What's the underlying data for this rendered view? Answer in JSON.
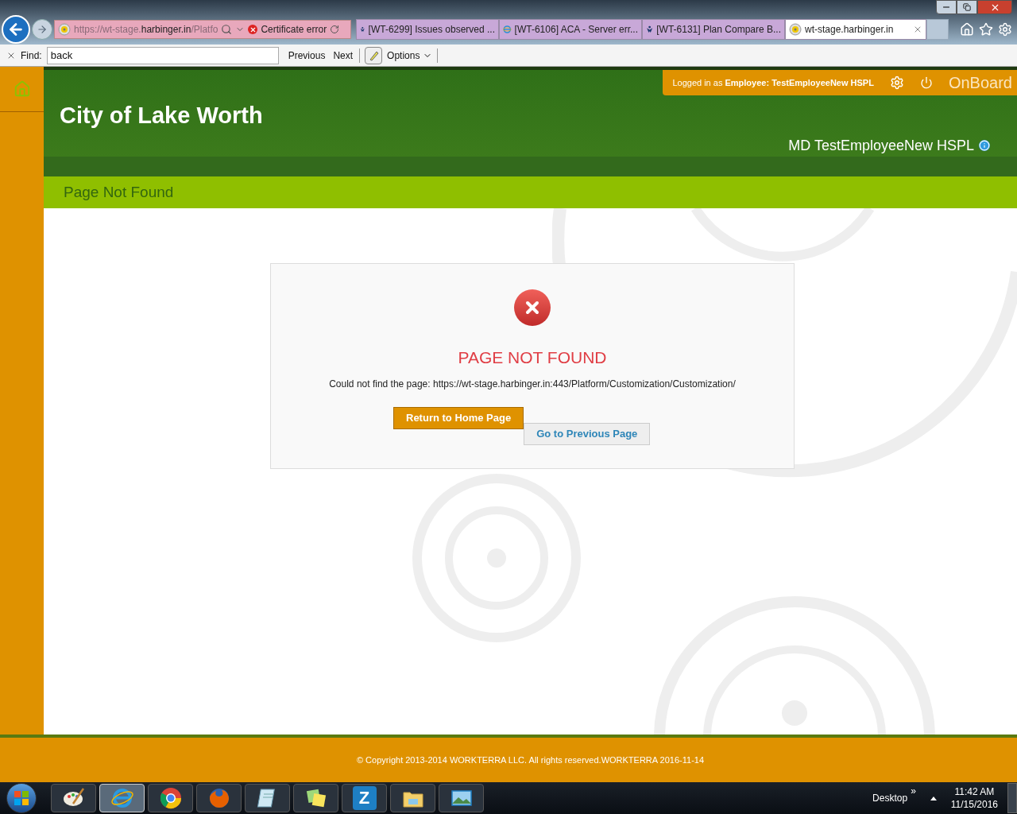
{
  "browser": {
    "address": {
      "prefix": "https://wt-stage.",
      "host": "harbinger.in",
      "rest": "/Platfo"
    },
    "certificate": "Certificate error",
    "tabs": [
      {
        "label": "[WT-6299] Issues observed ...",
        "kind": "jira",
        "selected": false
      },
      {
        "label": "[WT-6106] ACA - Server err...",
        "kind": "ie",
        "selected": false
      },
      {
        "label": "[WT-6131] Plan Compare B...",
        "kind": "jira",
        "selected": false
      },
      {
        "label": "wt-stage.harbinger.in",
        "kind": "site",
        "selected": true
      }
    ],
    "find": {
      "label": "Find:",
      "value": "back",
      "previous": "Previous",
      "next": "Next",
      "options": "Options"
    }
  },
  "header": {
    "org": "City of Lake Worth",
    "login": "Logged in as **Employee:  TestEmployeeNew HSPL**",
    "app": "OnBoard",
    "user": "MD TestEmployeeNew HSPL"
  },
  "page_title": "Page Not Found",
  "error": {
    "title": "PAGE NOT FOUND",
    "message": "Could not find the page: https://wt-stage.harbinger.in:443/Platform/Customization/Customization/",
    "home_button": "Return to Home Page",
    "previous_button": "Go to Previous Page"
  },
  "footer": "© Copyright 2013-2014 WORKTERRA LLC. All rights reserved.WORKTERRA 2016-11-14",
  "taskbar": {
    "apps": [
      {
        "kind": "paint",
        "selected": false
      },
      {
        "kind": "ie",
        "selected": true
      },
      {
        "kind": "chrome",
        "selected": false
      },
      {
        "kind": "firefox",
        "selected": false
      },
      {
        "kind": "notepad",
        "selected": false
      },
      {
        "kind": "notes",
        "selected": false
      },
      {
        "kind": "letter",
        "label": "Z",
        "selected": false
      },
      {
        "kind": "folder",
        "selected": false
      },
      {
        "kind": "photo",
        "selected": false
      }
    ],
    "desktop": "Desktop",
    "chevron": "»",
    "time": "11:42 AM",
    "date": "11/15/2016"
  }
}
